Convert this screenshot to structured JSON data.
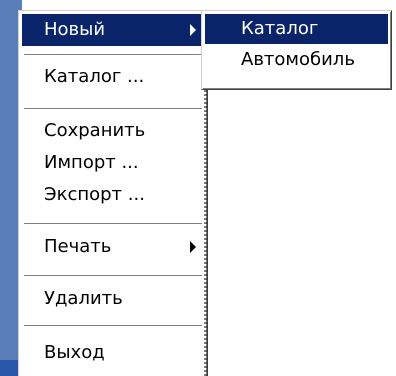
{
  "main_menu": {
    "items": [
      {
        "label": "Новый",
        "has_submenu": true,
        "selected": true
      },
      {
        "label": "Каталог ...",
        "has_submenu": false,
        "selected": false
      },
      {
        "label": "Сохранить",
        "has_submenu": false,
        "selected": false
      },
      {
        "label": "Импорт ...",
        "has_submenu": false,
        "selected": false
      },
      {
        "label": "Экспорт ...",
        "has_submenu": false,
        "selected": false
      },
      {
        "label": "Печать",
        "has_submenu": true,
        "selected": false
      },
      {
        "label": "Удалить",
        "has_submenu": false,
        "selected": false
      },
      {
        "label": "Выход",
        "has_submenu": false,
        "selected": false
      }
    ]
  },
  "submenu": {
    "items": [
      {
        "label": "Каталог",
        "selected": true
      },
      {
        "label": "Автомобиль",
        "selected": false
      }
    ]
  },
  "colors": {
    "highlight": "#0a246a",
    "highlight_text": "#ffffff",
    "menu_background": "#ffffff",
    "separator": "#808080"
  },
  "icons": {
    "submenu_arrow": "triangle-right-icon"
  }
}
